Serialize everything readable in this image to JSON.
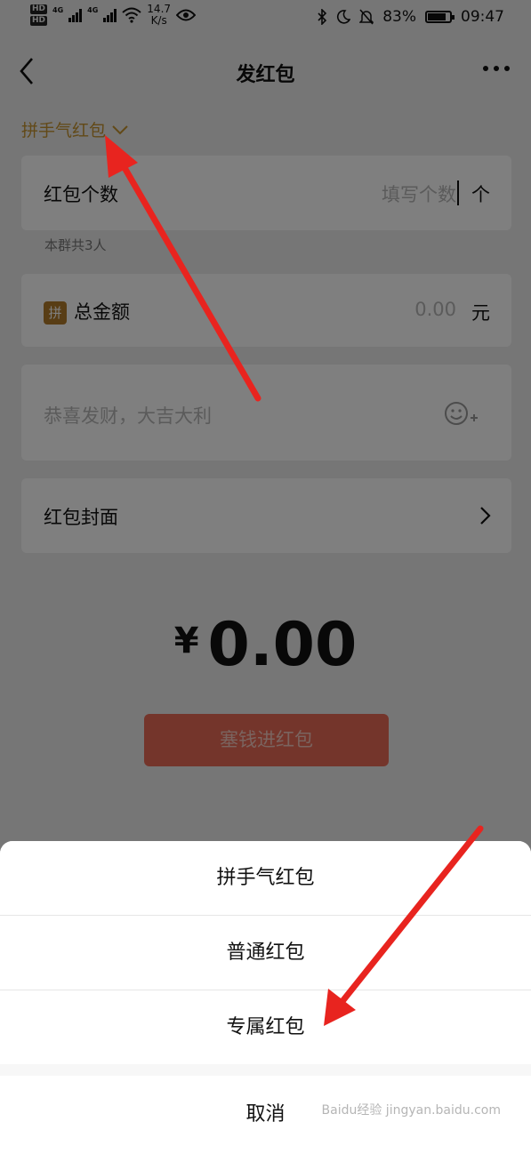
{
  "status_bar": {
    "hd1": "HD",
    "hd2": "HD",
    "net1": "4G",
    "net2": "4G",
    "speed_value": "14.7",
    "speed_unit": "K/s",
    "battery": "83%",
    "battery_level": 0.83,
    "time": "09:47"
  },
  "header": {
    "title": "发红包"
  },
  "type_selector": {
    "label": "拼手气红包"
  },
  "count_row": {
    "label": "红包个数",
    "placeholder": "填写个数",
    "unit": "个"
  },
  "group_hint": "本群共3人",
  "amount_row": {
    "badge": "拼",
    "label": "总金额",
    "placeholder": "0.00",
    "unit": "元"
  },
  "message": {
    "placeholder": "恭喜发财，大吉大利"
  },
  "cover_row": {
    "label": "红包封面"
  },
  "total": {
    "currency": "¥",
    "value": "0.00"
  },
  "submit_button": "塞钱进红包",
  "sheet": {
    "options": [
      "拼手气红包",
      "普通红包",
      "专属红包"
    ],
    "cancel": "取消"
  },
  "watermark": "Baidu经验 jingyan.baidu.com",
  "colors": {
    "accent_gold": "#c4922f",
    "button_red": "#e96a57",
    "annotation_red": "#e8241f"
  }
}
